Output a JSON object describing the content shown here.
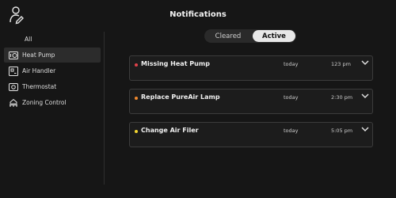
{
  "header": {
    "title": "Notifications",
    "user_icon": "user-icon"
  },
  "sidebar": {
    "items": [
      {
        "label": "All",
        "icon": "",
        "active": false
      },
      {
        "label": "Heat Pump",
        "icon": "heat-pump-icon",
        "active": true
      },
      {
        "label": "Air Handler",
        "icon": "air-handler-icon",
        "active": false
      },
      {
        "label": "Thermostat",
        "icon": "thermostat-icon",
        "active": false
      },
      {
        "label": "Zoning Control",
        "icon": "zoning-control-icon",
        "active": false
      }
    ]
  },
  "toggle": {
    "cleared_label": "Cleared",
    "active_label": "Active",
    "selected": "Active"
  },
  "notifications": [
    {
      "title": "Missing Heat Pump",
      "day": "today",
      "time": "123 pm",
      "color": "#e0424a"
    },
    {
      "title": "Replace PureAir Lamp",
      "day": "today",
      "time": "2:30 pm",
      "color": "#f0892e"
    },
    {
      "title": "Change Air Filer",
      "day": "today",
      "time": "5:05 pm",
      "color": "#f2d531"
    }
  ],
  "colors": {
    "background": "#161616",
    "card_border": "#3c3c3c",
    "toggle_active": "#e8e8e8"
  }
}
